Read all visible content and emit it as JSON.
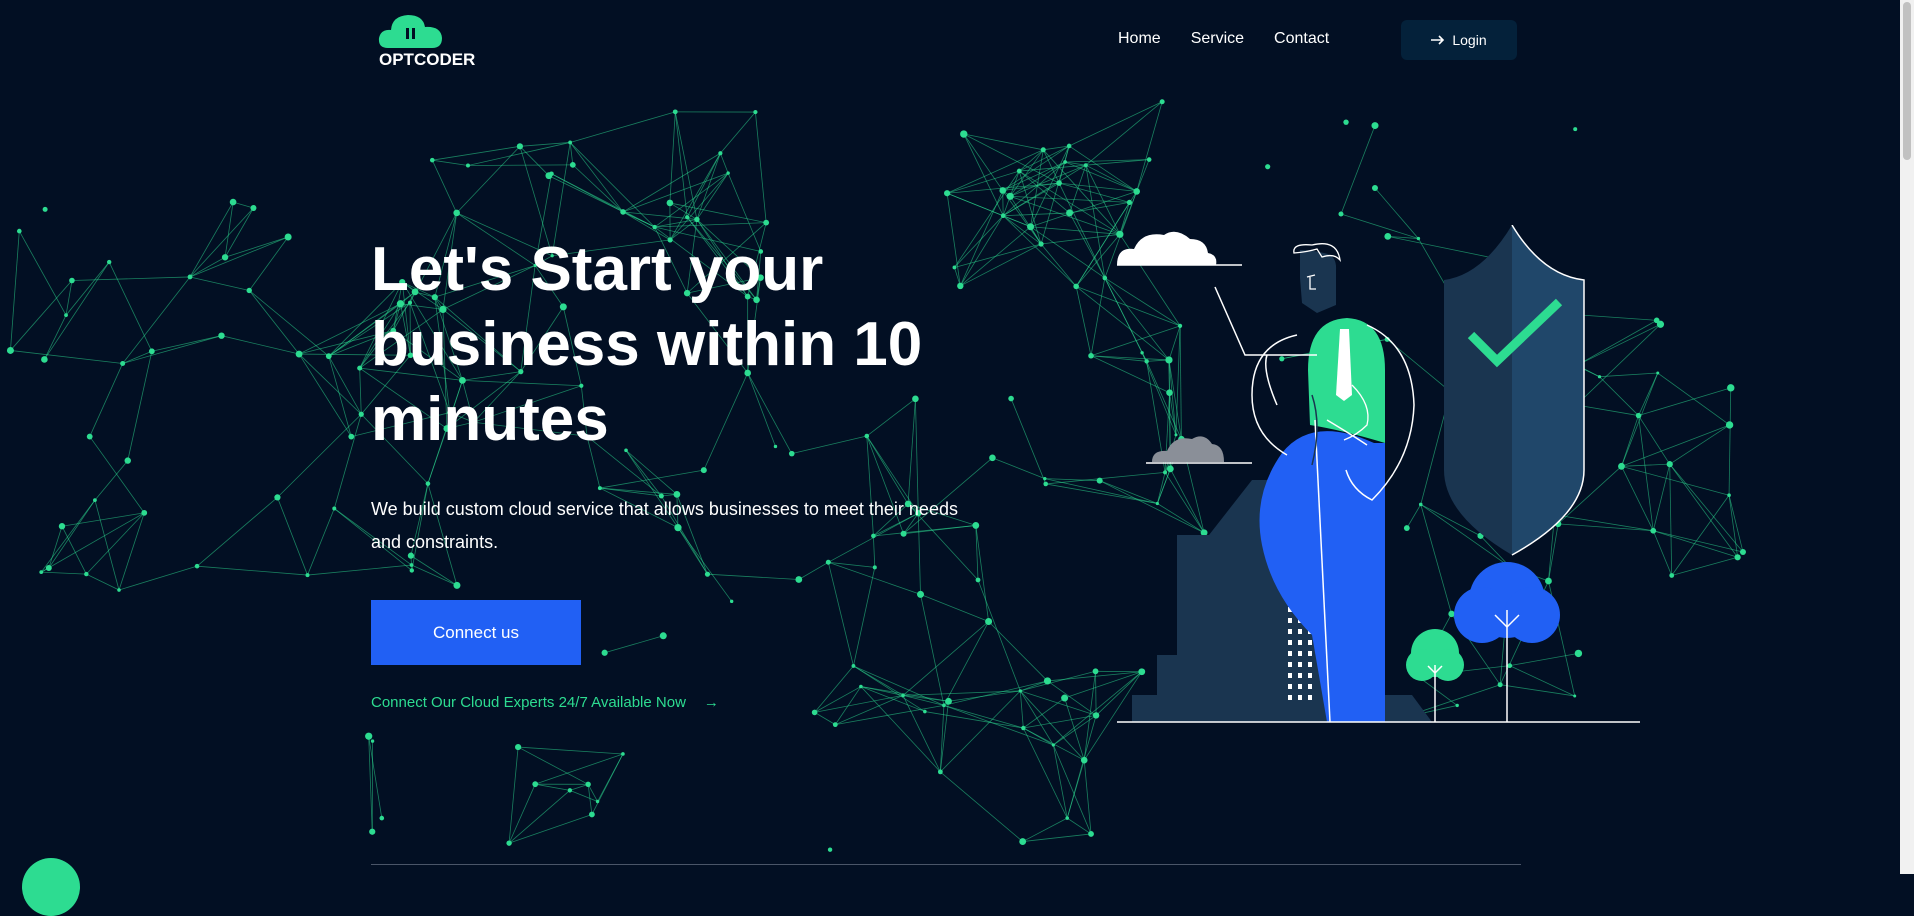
{
  "brand": {
    "logo_text": "OPTCODER"
  },
  "nav": {
    "items": [
      {
        "label": "Home"
      },
      {
        "label": "Service"
      },
      {
        "label": "Contact"
      }
    ],
    "login_icon": "arrow-right-icon",
    "login_label": "Login"
  },
  "hero": {
    "title": "Let's Start your business within 10 minutes",
    "subtitle": "We build custom cloud service that allows businesses to meet their needs and constraints.",
    "cta_label": "Connect us",
    "expert_link": "Connect Our Cloud Experts 24/7 Available Now",
    "expert_arrow": "→"
  },
  "colors": {
    "background": "#020f23",
    "accent_green": "#2ddc91",
    "accent_blue": "#2160f4",
    "navy": "#1a3550"
  }
}
